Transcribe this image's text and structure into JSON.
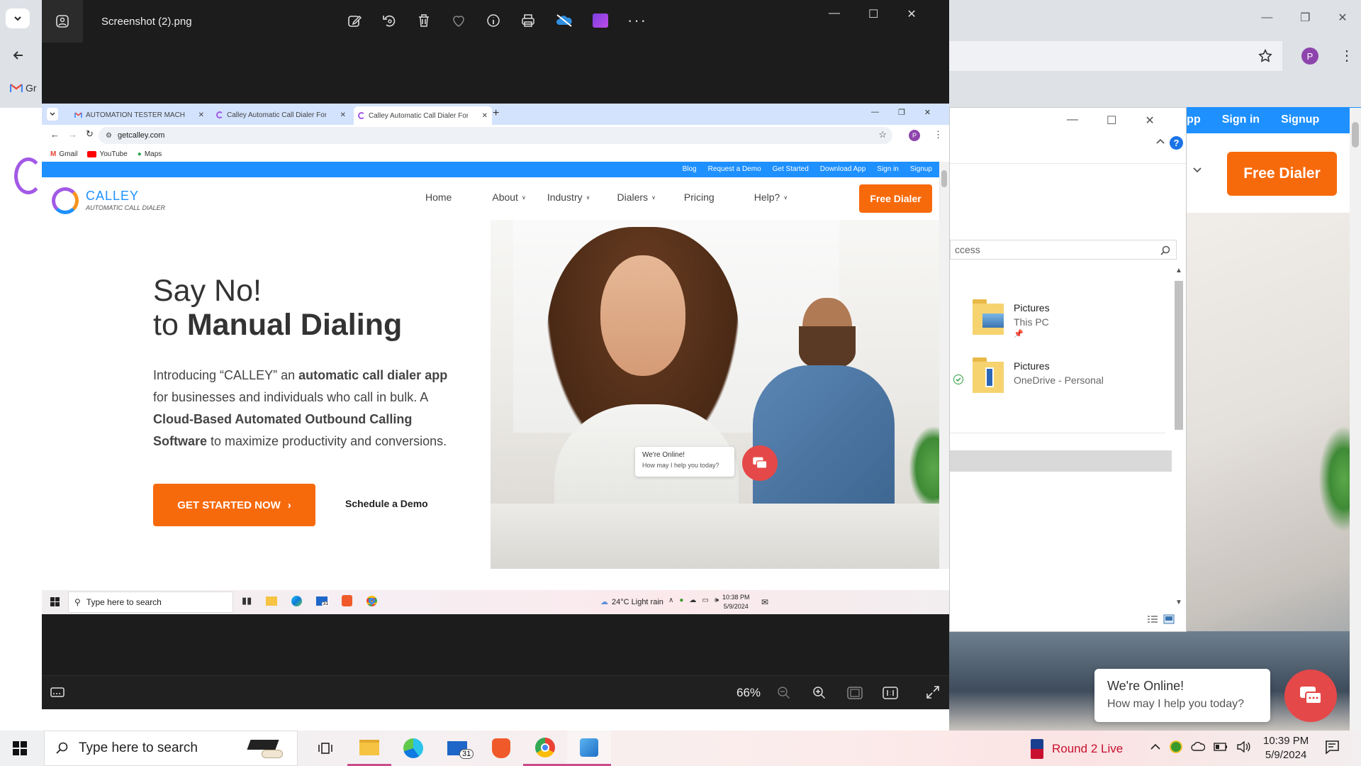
{
  "photos_app": {
    "title": "Screenshot (2).png",
    "zoom": "66%"
  },
  "inner_browser": {
    "tabs": [
      "AUTOMATION TESTER MACHIN",
      "Calley Automatic Call Dialer For",
      "Calley Automatic Call Dialer For"
    ],
    "url": "getcalley.com",
    "bookmarks": [
      "Gmail",
      "YouTube",
      "Maps"
    ],
    "avatar": "P"
  },
  "site": {
    "topbar": [
      "Blog",
      "Request a Demo",
      "Get Started",
      "Download App",
      "Sign in",
      "Signup"
    ],
    "logo_main": "CALLEY",
    "logo_sub": "AUTOMATIC CALL DIALER",
    "nav": [
      "Home",
      "About",
      "Industry",
      "Dialers",
      "Pricing",
      "Help?"
    ],
    "cta": "Free Dialer",
    "hero_line1": "Say No!",
    "hero_line2_pre": "to ",
    "hero_line2_bold": "Manual Dialing",
    "desc_1": "Introducing “CALLEY” an ",
    "desc_2": "automatic call dialer app",
    "desc_3": " for businesses and individuals who call in bulk. A ",
    "desc_4": "Cloud-Based Automated Outbound Calling Software",
    "desc_5": " to maximize productivity and conversions.",
    "get_started": "GET STARTED NOW",
    "get_started_arrow": "›",
    "schedule": "Schedule a Demo",
    "chat_title": "We're Online!",
    "chat_sub": "How may I help you today?"
  },
  "inner_taskbar": {
    "search": "Type here to search",
    "weather": "24°C  Light rain",
    "time": "10:38 PM",
    "date": "5/9/2024",
    "mail_badge": "31"
  },
  "bg_browser": {
    "gmail_partial": "Gr",
    "avatar": "P",
    "topbar": [
      "d App",
      "Sign in",
      "Signup"
    ],
    "cta": "Free Dialer",
    "chat_title": "We're Online!",
    "chat_sub": "How may I help you today?"
  },
  "explorer": {
    "search_partial": "ccess",
    "items": [
      {
        "name": "Pictures",
        "location": "This PC"
      },
      {
        "name": "Pictures",
        "location": "OneDrive - Personal"
      }
    ]
  },
  "taskbar": {
    "search": "Type here to search",
    "live": "Round 2 Live",
    "time": "10:39 PM",
    "date": "5/9/2024",
    "mail_badge": "31"
  }
}
